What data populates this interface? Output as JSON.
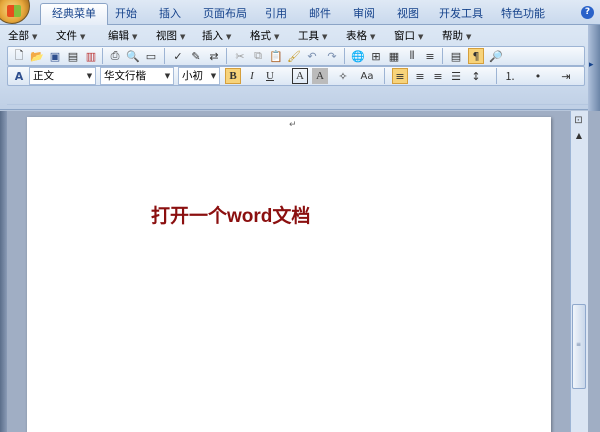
{
  "tabs": [
    "经典菜单",
    "开始",
    "插入",
    "页面布局",
    "引用",
    "邮件",
    "审阅",
    "视图",
    "开发工具",
    "特色功能"
  ],
  "menus": [
    "全部",
    "文件",
    "编辑",
    "视图",
    "插入",
    "格式",
    "工具",
    "表格",
    "窗口",
    "帮助"
  ],
  "format": {
    "style": "正文",
    "font": "华文行楷",
    "size": "小初",
    "bold": "B",
    "italic": "I",
    "underline": "U",
    "char_border": "A",
    "char_shade": "A",
    "case": "Aa"
  },
  "document": {
    "paragraph_mark": "↵",
    "text": "打开一个word文档",
    "text_color": "#8b0f0f"
  },
  "icons": {
    "help": "?",
    "ruler": "ruler-icon"
  }
}
